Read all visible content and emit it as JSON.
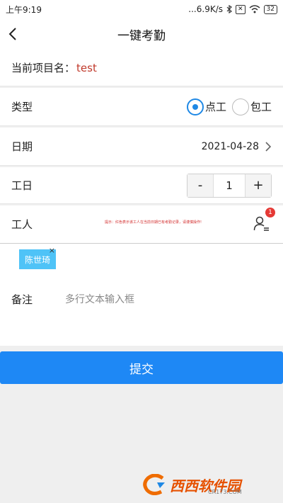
{
  "status_bar": {
    "time": "上午9:19",
    "network": "...6.9K/s",
    "battery": "32"
  },
  "header": {
    "title": "一键考勤"
  },
  "project": {
    "label": "当前项目名：",
    "value": "test"
  },
  "type": {
    "label": "类型",
    "options": [
      {
        "label": "点工",
        "checked": true
      },
      {
        "label": "包工",
        "checked": false
      }
    ],
    "accent_color": "#1e88e5"
  },
  "date": {
    "label": "日期",
    "value": "2021-04-28"
  },
  "workday": {
    "label": "工日",
    "minus": "-",
    "value": "1",
    "plus": "+"
  },
  "workers": {
    "label": "工人",
    "hint": "提示：红色表示该工人在当前日期已有考勤记录，请谨慎操作!",
    "badge_count": "1",
    "selected": [
      {
        "name": "陈世琦",
        "remove": "×"
      }
    ]
  },
  "remark": {
    "label": "备注",
    "placeholder": "多行文本输入框"
  },
  "submit": {
    "label": "提交",
    "color": "#1e88f5"
  },
  "watermark": {
    "brand": "西西软件园",
    "url": "CR173.COM"
  }
}
